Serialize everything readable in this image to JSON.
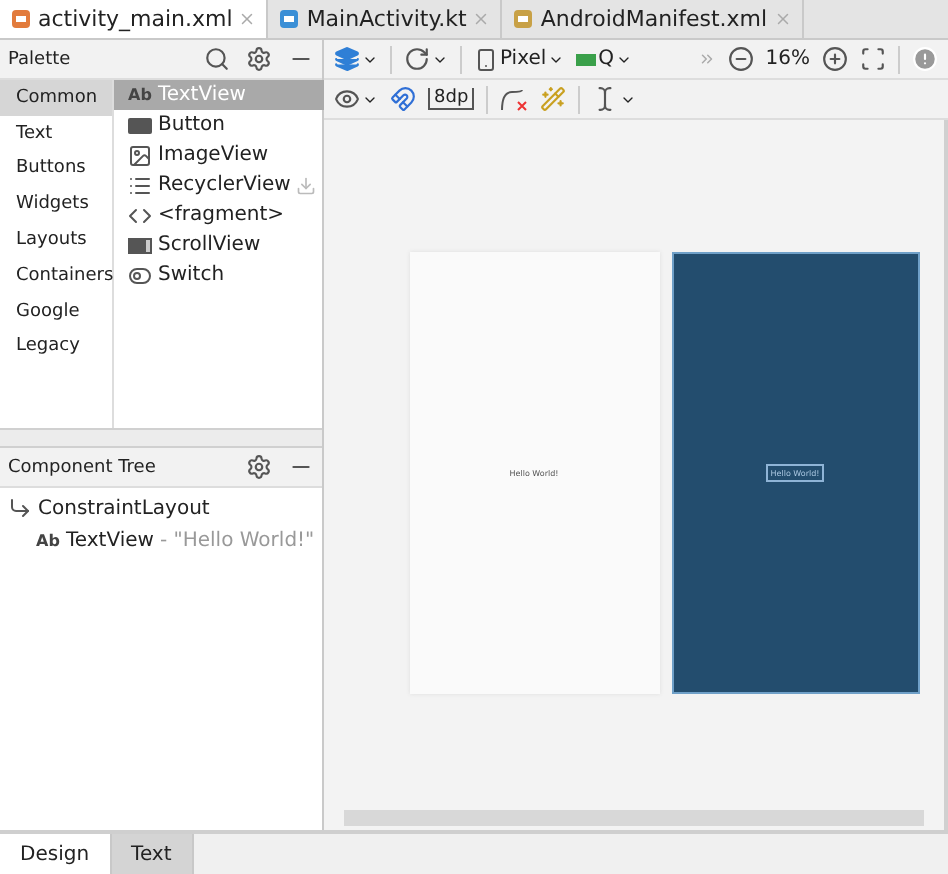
{
  "tabs": [
    {
      "label": "activity_main.xml",
      "kind": "layout",
      "selected": true
    },
    {
      "label": "MainActivity.kt",
      "kind": "kotlin",
      "selected": false
    },
    {
      "label": "AndroidManifest.xml",
      "kind": "manifest",
      "selected": false
    }
  ],
  "palette": {
    "title": "Palette",
    "categories": [
      {
        "label": "Common",
        "selected": true
      },
      {
        "label": "Text",
        "selected": false
      },
      {
        "label": "Buttons",
        "selected": false
      },
      {
        "label": "Widgets",
        "selected": false
      },
      {
        "label": "Layouts",
        "selected": false
      },
      {
        "label": "Containers",
        "selected": false
      },
      {
        "label": "Google",
        "selected": false
      },
      {
        "label": "Legacy",
        "selected": false
      }
    ],
    "widgets": [
      {
        "label": "TextView",
        "kind": "glyph",
        "glyph": "Ab",
        "selected": true,
        "download": false
      },
      {
        "label": "Button",
        "kind": "button",
        "selected": false,
        "download": false
      },
      {
        "label": "ImageView",
        "kind": "image",
        "selected": false,
        "download": false
      },
      {
        "label": "RecyclerView",
        "kind": "list",
        "selected": false,
        "download": true
      },
      {
        "label": "<fragment>",
        "kind": "code",
        "selected": false,
        "download": false
      },
      {
        "label": "ScrollView",
        "kind": "scroll",
        "selected": false,
        "download": false
      },
      {
        "label": "Switch",
        "kind": "switch",
        "selected": false,
        "download": false
      }
    ]
  },
  "toolbar": {
    "margin": "8dp",
    "device": "Pixel",
    "api": "Q",
    "zoom": "16%"
  },
  "component_tree": {
    "title": "Component Tree",
    "nodes": [
      {
        "label": "ConstraintLayout",
        "kind": "constraint",
        "children": [
          {
            "label": "TextView",
            "kind": "glyph",
            "glyph": "Ab",
            "detail": "- \"Hello World!\""
          }
        ]
      }
    ]
  },
  "design": {
    "text": "Hello World!"
  },
  "blueprint": {
    "text": "Hello World!"
  },
  "bottom_tabs": [
    {
      "label": "Design",
      "selected": true
    },
    {
      "label": "Text",
      "selected": false
    }
  ]
}
